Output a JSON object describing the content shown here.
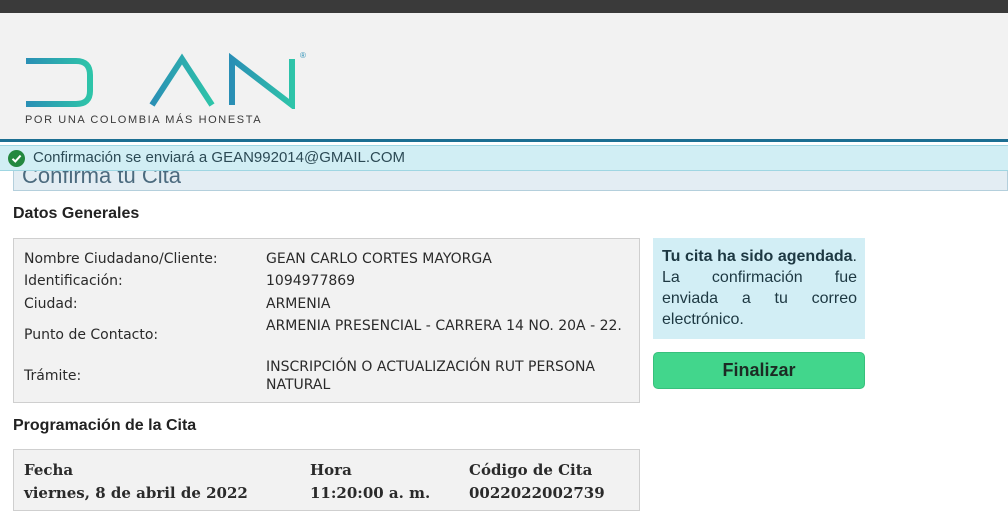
{
  "brand": {
    "name": "DIAN",
    "tagline": "POR UNA COLOMBIA MÁS HONESTA",
    "color": "#2a8fb5",
    "accent_color": "#2ec4a9"
  },
  "alert": {
    "message": "Confirmación se enviará a GEAN992014@GMAIL.COM",
    "icon": "check-circle-icon",
    "color": "#23883f"
  },
  "page": {
    "heading": "Confirma tu Cita"
  },
  "general": {
    "title": "Datos Generales",
    "rows": [
      {
        "label": "Nombre Ciudadano/Cliente:",
        "value": "GEAN CARLO CORTES MAYORGA"
      },
      {
        "label": "Identificación:",
        "value": "1094977869"
      },
      {
        "label": "Ciudad:",
        "value": "ARMENIA"
      },
      {
        "label": "Punto de Contacto:",
        "value": "ARMENIA PRESENCIAL - CARRERA 14 NO. 20A - 22."
      },
      {
        "label": "Trámite:",
        "value": "INSCRIPCIÓN O ACTUALIZACIÓN RUT PERSONA NATURAL"
      }
    ]
  },
  "notice": {
    "bold_text": "Tu cita ha sido agendada",
    "rest_text": ". La confirmación fue enviada a tu correo electrónico."
  },
  "actions": {
    "finish_label": "Finalizar",
    "finish_color": "#42d68c"
  },
  "schedule": {
    "title": "Programación de la Cita",
    "columns": [
      {
        "header": "Fecha",
        "value": "viernes, 8 de abril de 2022"
      },
      {
        "header": "Hora",
        "value": "11:20:00 a. m."
      },
      {
        "header": "Código de Cita",
        "value": "0022022002739"
      }
    ]
  }
}
